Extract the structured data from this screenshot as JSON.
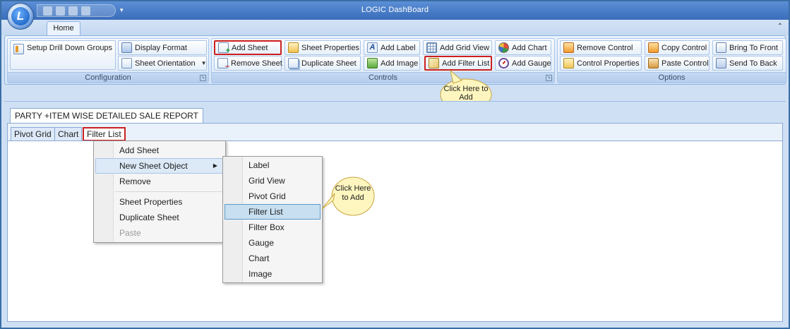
{
  "app": {
    "title": "LOGIC DashBoard",
    "orb_letter": "L"
  },
  "ribbon": {
    "tabs": [
      {
        "label": "Home"
      }
    ],
    "groups": {
      "configuration": {
        "label": "Configuration",
        "setup_drill": "Setup Drill Down Groups",
        "display_format": "Display Format",
        "sheet_orientation": "Sheet Orientation"
      },
      "controls": {
        "label": "Controls",
        "add_sheet": "Add Sheet",
        "remove_sheet": "Remove Sheet",
        "sheet_properties": "Sheet Properties",
        "duplicate_sheet": "Duplicate Sheet",
        "add_label": "Add Label",
        "add_image": "Add Image",
        "add_grid_view": "Add Grid View",
        "add_filter_list": "Add Filter List",
        "add_chart": "Add Chart",
        "add_gauge": "Add Gauge"
      },
      "options": {
        "label": "Options",
        "remove_control": "Remove Control",
        "control_properties": "Control Properties",
        "copy_control": "Copy Control",
        "paste_control": "Paste Control",
        "bring_to_front": "Bring To Front",
        "send_to_back": "Send To Back"
      }
    }
  },
  "callouts": {
    "ribbon": "Click Here to Add",
    "menu": "Click Here to Add"
  },
  "document": {
    "report_tab": "PARTY +ITEM WISE DETAILED SALE REPORT",
    "sheet_tabs": [
      {
        "label": "Pivot Grid"
      },
      {
        "label": "Chart"
      },
      {
        "label": "Filter List"
      }
    ]
  },
  "context_menu": {
    "items": {
      "add_sheet": "Add Sheet",
      "new_sheet_object": "New Sheet Object",
      "remove": "Remove",
      "sheet_properties": "Sheet Properties",
      "duplicate_sheet": "Duplicate Sheet",
      "paste": "Paste"
    },
    "submenu": [
      "Label",
      "Grid View",
      "Pivot Grid",
      "Filter List",
      "Filter Box",
      "Gauge",
      "Chart",
      "Image"
    ]
  }
}
